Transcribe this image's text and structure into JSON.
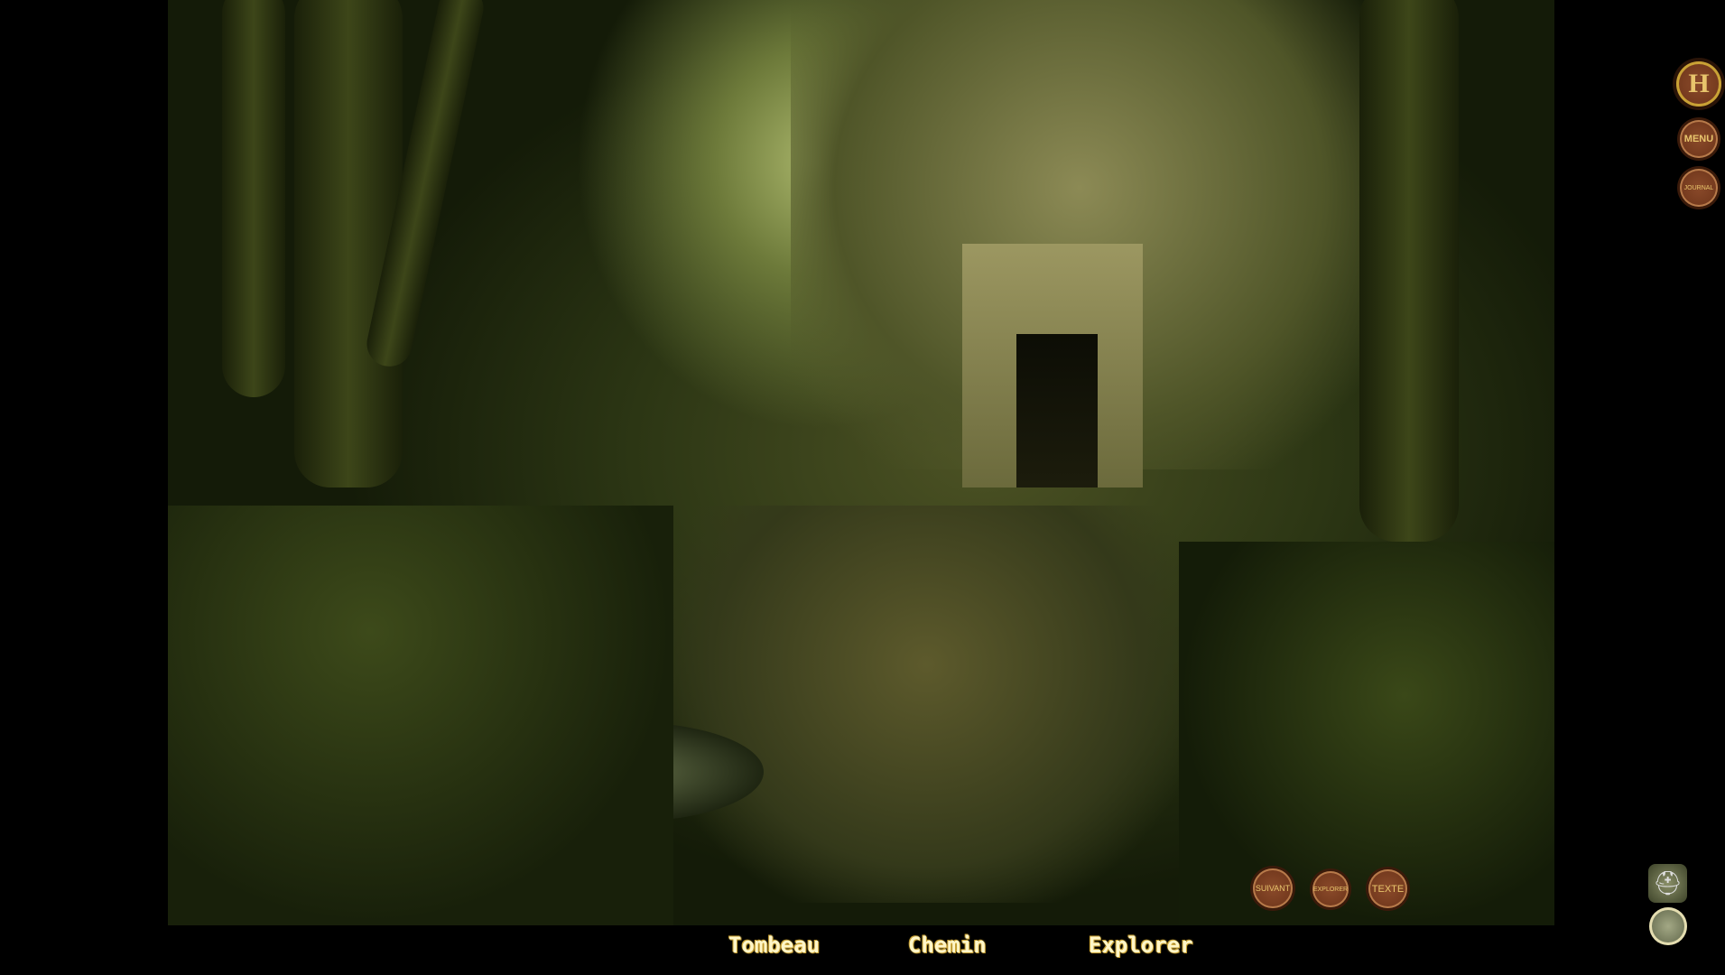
{
  "scene": {
    "description_icon": "forest-tomb-scene"
  },
  "side_buttons": {
    "home": "H",
    "menu": "MENU",
    "journal": "JOURNAL"
  },
  "action_buttons": {
    "next": "SUIVANT",
    "explore": "EXPLORER",
    "text": "TEXTE"
  },
  "bottom_nav": [
    {
      "label": "Tombeau"
    },
    {
      "label": "Chemin"
    },
    {
      "label": "Explorer"
    }
  ],
  "status_icons": {
    "avatar": "knight-helmet-icon",
    "map": "coin-map-icon"
  },
  "colors": {
    "button_bg": "#7a3d20",
    "button_text": "#e8c56c",
    "nav_text": "#fff6c8",
    "nav_outline": "#c9a235"
  }
}
